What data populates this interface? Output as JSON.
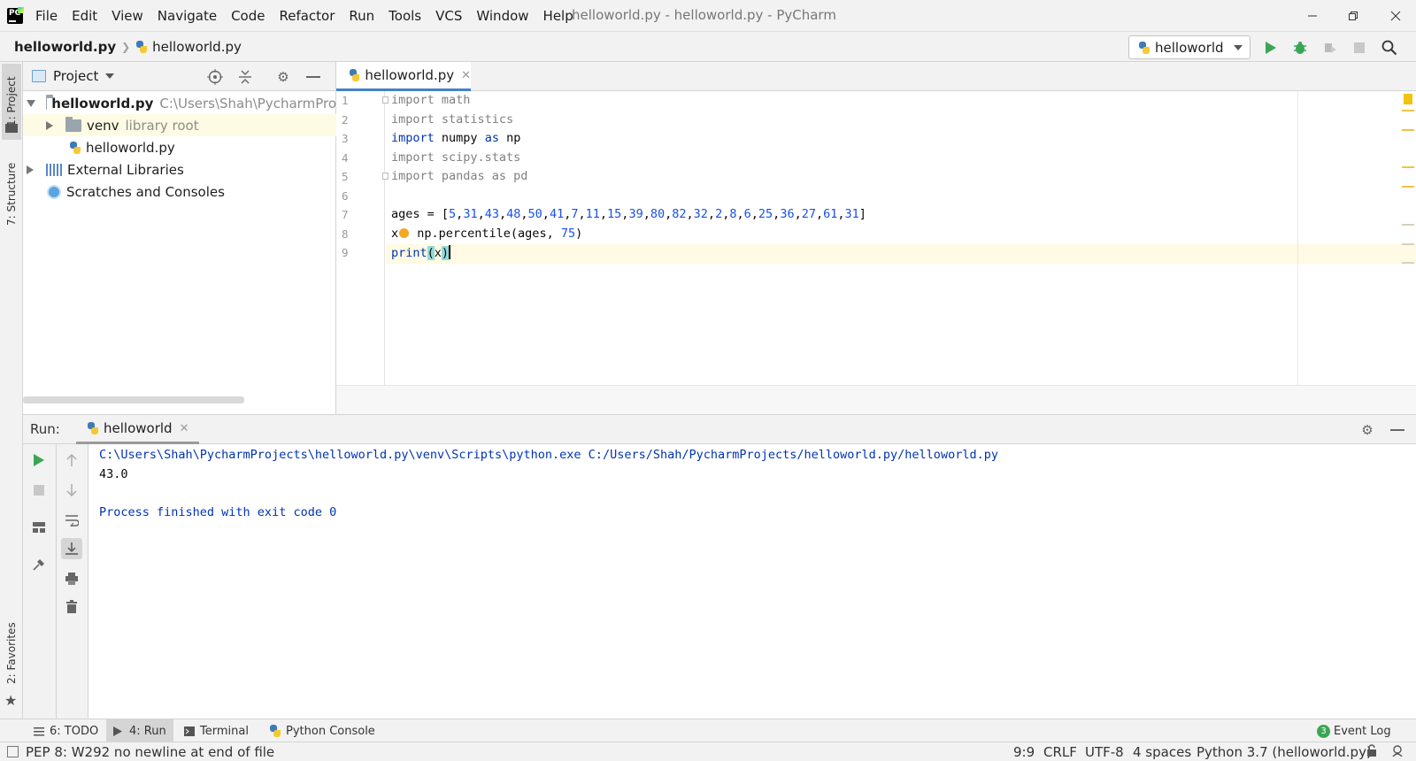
{
  "menu": [
    "File",
    "Edit",
    "View",
    "Navigate",
    "Code",
    "Refactor",
    "Run",
    "Tools",
    "VCS",
    "Window",
    "Help"
  ],
  "window_title": "helloworld.py - helloworld.py - PyCharm",
  "breadcrumb": {
    "root": "helloworld.py",
    "file": "helloworld.py"
  },
  "run_config": "helloworld",
  "left_strip": {
    "project_tab": "1: Project",
    "structure_tab": "7: Structure",
    "favorites_tab": "2: Favorites"
  },
  "project_panel": {
    "title": "Project",
    "tree": [
      {
        "label": "helloworld.py",
        "hint": "C:\\Users\\Shah\\PycharmPro",
        "type": "folder-root",
        "expanded": true
      },
      {
        "label": "venv",
        "hint": "library root",
        "type": "folder",
        "expanded": false
      },
      {
        "label": "helloworld.py",
        "hint": "",
        "type": "py-file"
      },
      {
        "label": "External Libraries",
        "hint": "",
        "type": "libraries",
        "expanded": false
      },
      {
        "label": "Scratches and Consoles",
        "hint": "",
        "type": "scratches"
      }
    ]
  },
  "editor": {
    "tab_label": "helloworld.py",
    "line_numbers": [
      "1",
      "2",
      "3",
      "4",
      "5",
      "6",
      "7",
      "8",
      "9"
    ],
    "lines": [
      "import math",
      "import statistics",
      "import numpy as np",
      "import scipy.stats",
      "import pandas as pd",
      "",
      "ages = [5,31,43,48,50,41,7,11,15,39,80,82,32,2,8,6,25,36,27,61,31]",
      "x = np.percentile(ages, 75)",
      "print(x)"
    ]
  },
  "run_panel": {
    "label": "Run:",
    "tab": "helloworld",
    "console": [
      "C:\\Users\\Shah\\PycharmProjects\\helloworld.py\\venv\\Scripts\\python.exe C:/Users/Shah/PycharmProjects/helloworld.py/helloworld.py",
      "43.0",
      "Process finished with exit code 0"
    ]
  },
  "tool_windows": {
    "todo": "6: TODO",
    "run": "4: Run",
    "terminal": "Terminal",
    "python_console": "Python Console",
    "event_log": "Event Log",
    "event_count": "3"
  },
  "status_bar": {
    "message": "PEP 8: W292 no newline at end of file",
    "position": "9:9",
    "line_sep": "CRLF",
    "encoding": "UTF-8",
    "indent": "4 spaces",
    "interpreter": "Python 3.7 (helloworld.py)"
  },
  "colors": {
    "keyword": "#0033b3",
    "number": "#1750eb",
    "unused_import": "#808080",
    "run_green": "#3aa655",
    "tab_accent": "#4083c9"
  }
}
